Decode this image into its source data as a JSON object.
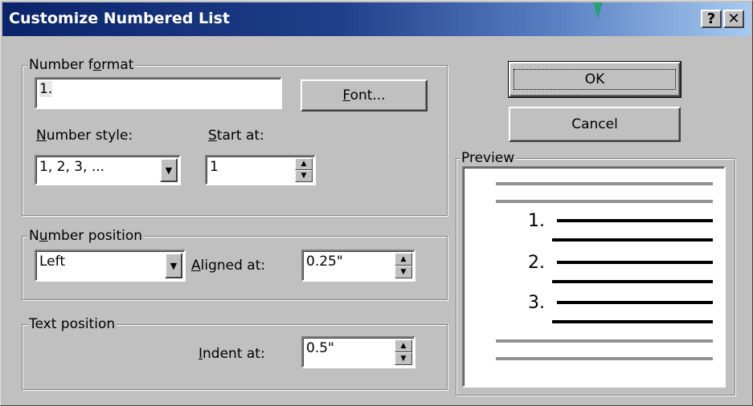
{
  "title": "Customize Numbered List",
  "titlebar_buttons": {
    "help": "?",
    "close": "✕"
  },
  "number_format": {
    "legend": "Number format",
    "format_value": "1.",
    "font_button": "Font...",
    "number_style_label": "Number style:",
    "number_style_value": "1, 2, 3, ...",
    "start_at_label": "Start at:",
    "start_at_value": "1"
  },
  "number_position": {
    "legend": "Number position",
    "alignment_value": "Left",
    "aligned_at_label": "Aligned at:",
    "aligned_at_value": "0.25\""
  },
  "text_position": {
    "legend": "Text position",
    "indent_at_label": "Indent at:",
    "indent_at_value": "0.5\""
  },
  "buttons": {
    "ok": "OK",
    "cancel": "Cancel"
  },
  "preview": {
    "legend": "Preview",
    "numbers": [
      "1.",
      "2.",
      "3."
    ]
  },
  "icons": {
    "dropdown": "down-arrow",
    "spin_up": "up-triangle",
    "spin_down": "down-triangle"
  }
}
